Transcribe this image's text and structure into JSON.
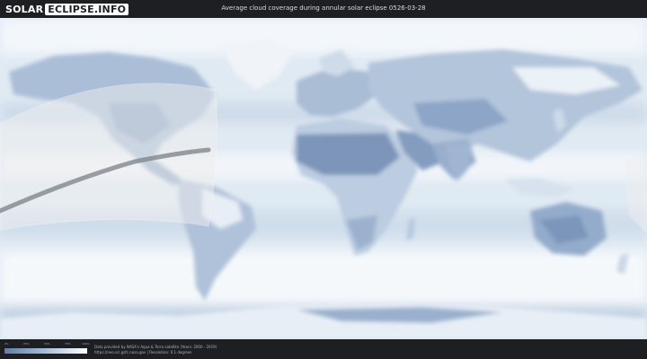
{
  "header": {
    "logo_part1": "SOLAR",
    "logo_part2": "ECLIPSE.INFO",
    "title": "Average cloud coverage during annular solar eclipse 0526-03-28"
  },
  "legend": {
    "labels": [
      "0%",
      "25%",
      "50%",
      "75%",
      "100%"
    ],
    "colors": [
      "#5f7fa8",
      "#8ea8c8",
      "#c4d4e6",
      "#ffffff"
    ]
  },
  "credits": {
    "line1": "Data provided by NASA's Aqua & Terra satellite (Years: 2000 - 2019)",
    "line2": "https://neo.sci.gsfc.nasa.gov | Resolution: 0.1 degrees"
  },
  "colors": {
    "background": "#1e1f22",
    "ocean": "#dfe9f3",
    "land_clear": "#6e8cb5",
    "cloudy": "#ffffff",
    "eclipse_zone": "#e6e6e6",
    "central_path": "#7a8087"
  }
}
